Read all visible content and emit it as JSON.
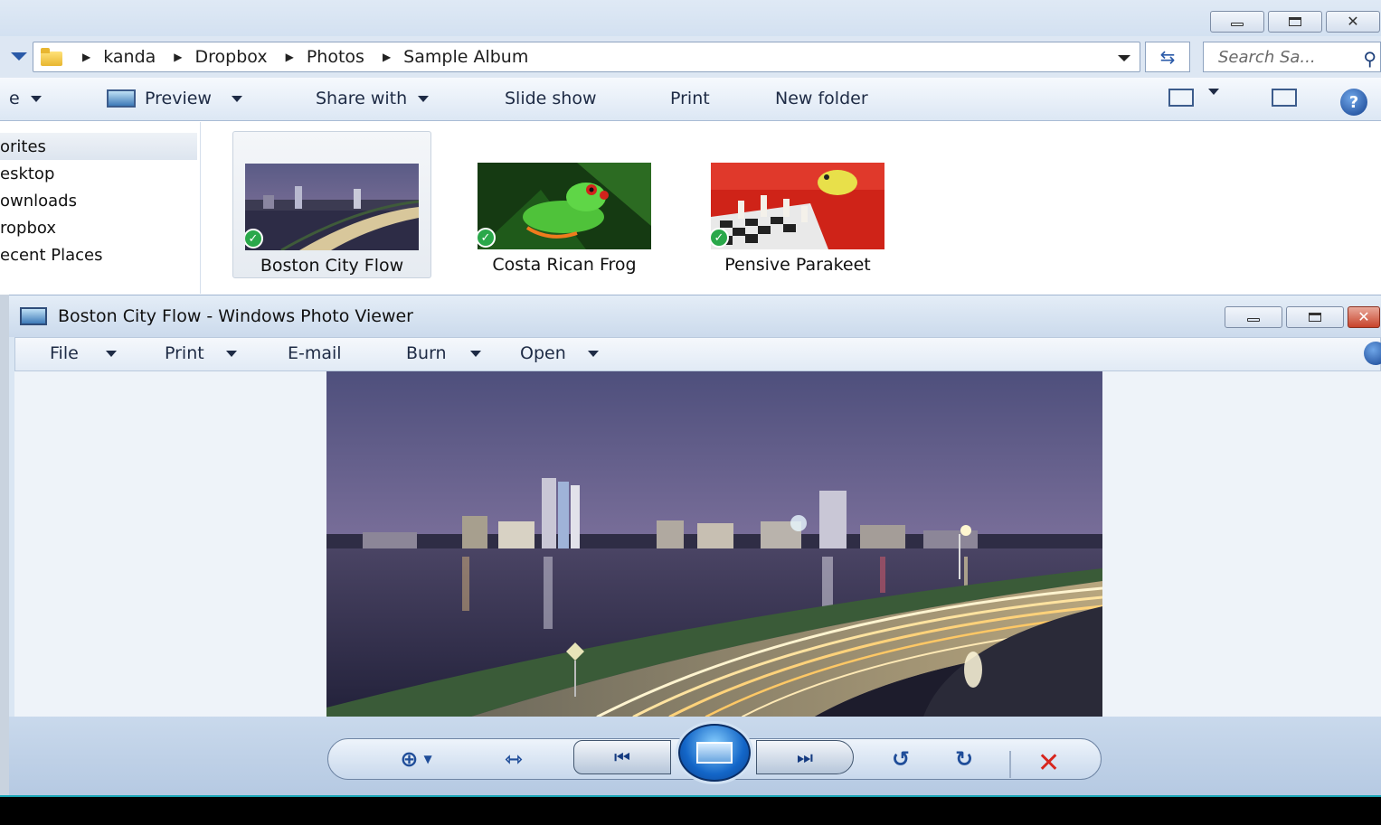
{
  "explorer": {
    "breadcrumb": [
      "kanda",
      "Dropbox",
      "Photos",
      "Sample Album"
    ],
    "search_placeholder": "Search Sa...",
    "commands": {
      "organize_partial": "e",
      "preview": "Preview",
      "share_with": "Share with",
      "slide_show": "Slide show",
      "print": "Print",
      "new_folder": "New folder"
    },
    "sidebar": {
      "header": "orites",
      "items": [
        "esktop",
        "ownloads",
        "ropbox",
        "ecent Places"
      ]
    },
    "files": [
      {
        "name": "Boston City Flow",
        "selected": true
      },
      {
        "name": "Costa Rican Frog",
        "selected": false
      },
      {
        "name": "Pensive Parakeet",
        "selected": false
      }
    ]
  },
  "viewer": {
    "title": "Boston City Flow - Windows Photo Viewer",
    "menu": [
      "File",
      "Print",
      "E-mail",
      "Burn",
      "Open"
    ],
    "controls": [
      "zoom-icon",
      "actual-size-icon",
      "previous-icon",
      "slideshow-icon",
      "next-icon",
      "rotate-left-icon",
      "rotate-right-icon",
      "delete-icon"
    ]
  },
  "colors": {
    "accent_blue": "#1f4d99",
    "delete_red": "#d7261e",
    "check_green": "#2aa84a",
    "taskbar_accent": "#1aa7b8"
  }
}
